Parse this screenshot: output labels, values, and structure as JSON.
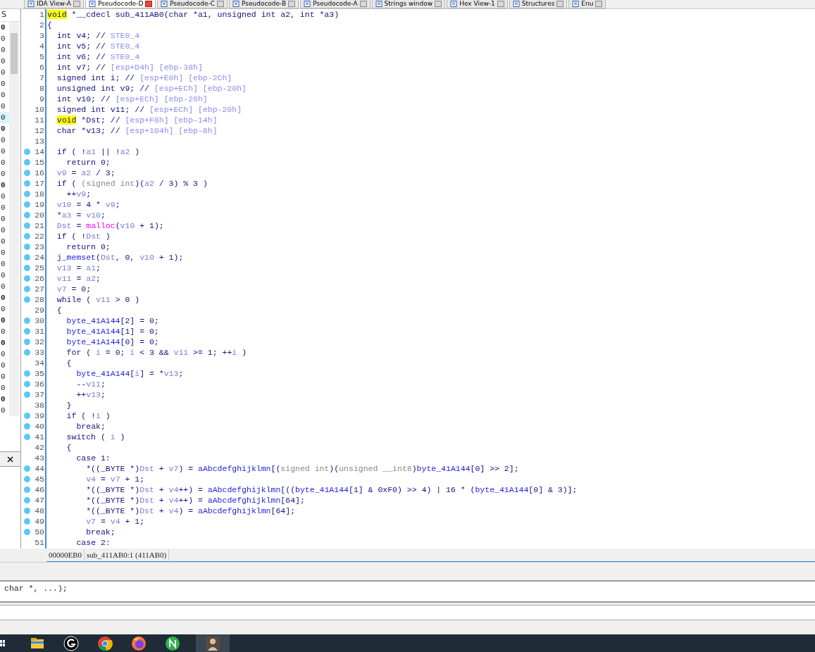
{
  "tabs": [
    {
      "label": "IDA View-A",
      "selected": false
    },
    {
      "label": "Pseudocode-D",
      "selected": true
    },
    {
      "label": "Pseudocode-C",
      "selected": false
    },
    {
      "label": "Pseudocode-B",
      "selected": false
    },
    {
      "label": "Pseudocode-A",
      "selected": false
    },
    {
      "label": "Strings window",
      "selected": false
    },
    {
      "label": "Hex View-1",
      "selected": false
    },
    {
      "label": "Structures",
      "selected": false
    },
    {
      "label": "Enu",
      "selected": false
    }
  ],
  "left_panel": {
    "header": "S",
    "rows": [
      {
        "text": "0",
        "bold": true,
        "selected": false
      },
      {
        "text": "0",
        "bold": false,
        "selected": false
      },
      {
        "text": "0",
        "bold": false,
        "selected": false
      },
      {
        "text": "0",
        "bold": false,
        "selected": false
      },
      {
        "text": "0",
        "bold": false,
        "selected": false
      },
      {
        "text": "0",
        "bold": false,
        "selected": false
      },
      {
        "text": "0",
        "bold": false,
        "selected": false
      },
      {
        "text": "0",
        "bold": false,
        "selected": false
      },
      {
        "text": "0",
        "bold": false,
        "selected": true
      },
      {
        "text": "0",
        "bold": true,
        "selected": false
      },
      {
        "text": "0",
        "bold": false,
        "selected": false
      },
      {
        "text": "0",
        "bold": false,
        "selected": false
      },
      {
        "text": "0",
        "bold": false,
        "selected": false
      },
      {
        "text": "0",
        "bold": false,
        "selected": false
      },
      {
        "text": "0",
        "bold": true,
        "selected": false
      },
      {
        "text": "0",
        "bold": false,
        "selected": false
      },
      {
        "text": "0",
        "bold": false,
        "selected": false
      },
      {
        "text": "0",
        "bold": false,
        "selected": false
      },
      {
        "text": "0",
        "bold": false,
        "selected": false
      },
      {
        "text": "0",
        "bold": false,
        "selected": false
      },
      {
        "text": "0",
        "bold": false,
        "selected": false
      },
      {
        "text": "0",
        "bold": false,
        "selected": false
      },
      {
        "text": "0",
        "bold": false,
        "selected": false
      },
      {
        "text": "0",
        "bold": false,
        "selected": false
      },
      {
        "text": "0",
        "bold": true,
        "selected": false
      },
      {
        "text": "0",
        "bold": false,
        "selected": false
      },
      {
        "text": "0",
        "bold": true,
        "selected": false
      },
      {
        "text": "0",
        "bold": false,
        "selected": false
      },
      {
        "text": "0",
        "bold": true,
        "selected": false
      },
      {
        "text": "0",
        "bold": false,
        "selected": false
      },
      {
        "text": "0",
        "bold": false,
        "selected": false
      },
      {
        "text": "0",
        "bold": false,
        "selected": false
      },
      {
        "text": "0",
        "bold": false,
        "selected": false
      },
      {
        "text": "0",
        "bold": true,
        "selected": false
      },
      {
        "text": "0",
        "bold": false,
        "selected": false
      }
    ]
  },
  "code_lines": [
    {
      "number": "1",
      "breakpoint": false,
      "code": [
        {
          "kind": "hl",
          "text": "void"
        },
        {
          "kind": "plain",
          "text": " *__cdecl sub_411AB0(char *a1, unsigned int a2, int *a3)"
        }
      ]
    },
    {
      "number": "2",
      "breakpoint": false,
      "code": [
        {
          "kind": "plain",
          "text": "{"
        }
      ]
    },
    {
      "number": "3",
      "breakpoint": false,
      "code": [
        {
          "kind": "plain",
          "text": "  int v4; // "
        },
        {
          "kind": "comment",
          "text": "STE0_4"
        }
      ]
    },
    {
      "number": "4",
      "breakpoint": false,
      "code": [
        {
          "kind": "plain",
          "text": "  int v5; // "
        },
        {
          "kind": "comment",
          "text": "STE0_4"
        }
      ]
    },
    {
      "number": "5",
      "breakpoint": false,
      "code": [
        {
          "kind": "plain",
          "text": "  int v6; // "
        },
        {
          "kind": "comment",
          "text": "STE0_4"
        }
      ]
    },
    {
      "number": "6",
      "breakpoint": false,
      "code": [
        {
          "kind": "plain",
          "text": "  int v7; // "
        },
        {
          "kind": "comment",
          "text": "[esp+D4h] [ebp-38h]"
        }
      ]
    },
    {
      "number": "7",
      "breakpoint": false,
      "code": [
        {
          "kind": "plain",
          "text": "  signed int i; // "
        },
        {
          "kind": "comment",
          "text": "[esp+E0h] [ebp-2Ch]"
        }
      ]
    },
    {
      "number": "8",
      "breakpoint": false,
      "code": [
        {
          "kind": "plain",
          "text": "  unsigned int v9; // "
        },
        {
          "kind": "comment",
          "text": "[esp+ECh] [ebp-20h]"
        }
      ]
    },
    {
      "number": "9",
      "breakpoint": false,
      "code": [
        {
          "kind": "plain",
          "text": "  int v10; // "
        },
        {
          "kind": "comment",
          "text": "[esp+ECh] [ebp-20h]"
        }
      ]
    },
    {
      "number": "10",
      "breakpoint": false,
      "code": [
        {
          "kind": "plain",
          "text": "  signed int v11; // "
        },
        {
          "kind": "comment",
          "text": "[esp+ECh] [ebp-20h]"
        }
      ]
    },
    {
      "number": "11",
      "breakpoint": false,
      "code": [
        {
          "kind": "hl",
          "text": "  void"
        },
        {
          "kind": "plain",
          "text": " *Dst; // "
        },
        {
          "kind": "comment",
          "text": "[esp+F8h] [ebp-14h]"
        }
      ]
    },
    {
      "number": "12",
      "breakpoint": false,
      "code": [
        {
          "kind": "plain",
          "text": "  char *v13; // "
        },
        {
          "kind": "comment",
          "text": "[esp+104h] [ebp-8h]"
        }
      ]
    },
    {
      "number": "13",
      "breakpoint": false
    },
    {
      "number": "14",
      "breakpoint": true,
      "code": [
        {
          "kind": "plain",
          "text": "  if ( !"
        },
        {
          "kind": "var",
          "text": "a1"
        },
        {
          "kind": "plain",
          "text": " || !"
        },
        {
          "kind": "var",
          "text": "a2"
        },
        {
          "kind": "plain",
          "text": " )"
        }
      ]
    },
    {
      "number": "15",
      "breakpoint": true,
      "code": [
        {
          "kind": "plain",
          "text": "    return 0;"
        }
      ]
    },
    {
      "number": "16",
      "breakpoint": true,
      "code": [
        {
          "kind": "var",
          "text": "  v9"
        },
        {
          "kind": "plain",
          "text": " = "
        },
        {
          "kind": "var",
          "text": "a2"
        },
        {
          "kind": "plain",
          "text": " / 3;"
        }
      ]
    },
    {
      "number": "17",
      "breakpoint": true,
      "code": [
        {
          "kind": "plain",
          "text": "  if ( "
        },
        {
          "kind": "cast",
          "text": "(signed int"
        },
        {
          "kind": "plain",
          "text": ")("
        },
        {
          "kind": "var",
          "text": "a2"
        },
        {
          "kind": "plain",
          "text": " / 3) % 3 )"
        }
      ]
    },
    {
      "number": "18",
      "breakpoint": true,
      "code": [
        {
          "kind": "plain",
          "text": "    ++"
        },
        {
          "kind": "var",
          "text": "v9"
        },
        {
          "kind": "plain",
          "text": ";"
        }
      ]
    },
    {
      "number": "19",
      "breakpoint": true,
      "code": [
        {
          "kind": "var",
          "text": "  v10"
        },
        {
          "kind": "plain",
          "text": " = 4 * "
        },
        {
          "kind": "var",
          "text": "v9"
        },
        {
          "kind": "plain",
          "text": ";"
        }
      ]
    },
    {
      "number": "20",
      "breakpoint": true,
      "code": [
        {
          "kind": "plain",
          "text": "  *"
        },
        {
          "kind": "var",
          "text": "a3"
        },
        {
          "kind": "plain",
          "text": " = "
        },
        {
          "kind": "var",
          "text": "v10"
        },
        {
          "kind": "plain",
          "text": ";"
        }
      ]
    },
    {
      "number": "21",
      "breakpoint": true,
      "code": [
        {
          "kind": "var",
          "text": "  Dst"
        },
        {
          "kind": "plain",
          "text": " = "
        },
        {
          "kind": "func",
          "text": "malloc"
        },
        {
          "kind": "plain",
          "text": "("
        },
        {
          "kind": "var",
          "text": "v10"
        },
        {
          "kind": "plain",
          "text": " + 1);"
        }
      ]
    },
    {
      "number": "22",
      "breakpoint": true,
      "code": [
        {
          "kind": "plain",
          "text": "  if ( !"
        },
        {
          "kind": "var",
          "text": "Dst"
        },
        {
          "kind": "plain",
          "text": " )"
        }
      ]
    },
    {
      "number": "23",
      "breakpoint": true,
      "code": [
        {
          "kind": "plain",
          "text": "    return 0;"
        }
      ]
    },
    {
      "number": "24",
      "breakpoint": true,
      "code": [
        {
          "kind": "global",
          "text": "  j_memset"
        },
        {
          "kind": "plain",
          "text": "("
        },
        {
          "kind": "var",
          "text": "Dst"
        },
        {
          "kind": "plain",
          "text": ", 0, "
        },
        {
          "kind": "var",
          "text": "v10"
        },
        {
          "kind": "plain",
          "text": " + 1);"
        }
      ]
    },
    {
      "number": "25",
      "breakpoint": true,
      "code": [
        {
          "kind": "var",
          "text": "  v13"
        },
        {
          "kind": "plain",
          "text": " = "
        },
        {
          "kind": "var",
          "text": "a1"
        },
        {
          "kind": "plain",
          "text": ";"
        }
      ]
    },
    {
      "number": "26",
      "breakpoint": true,
      "code": [
        {
          "kind": "var",
          "text": "  v11"
        },
        {
          "kind": "plain",
          "text": " = "
        },
        {
          "kind": "var",
          "text": "a2"
        },
        {
          "kind": "plain",
          "text": ";"
        }
      ]
    },
    {
      "number": "27",
      "breakpoint": true,
      "code": [
        {
          "kind": "var",
          "text": "  v7"
        },
        {
          "kind": "plain",
          "text": " = 0;"
        }
      ]
    },
    {
      "number": "28",
      "breakpoint": true,
      "code": [
        {
          "kind": "plain",
          "text": "  while ( "
        },
        {
          "kind": "var",
          "text": "v11"
        },
        {
          "kind": "plain",
          "text": " > 0 )"
        }
      ]
    },
    {
      "number": "29",
      "breakpoint": false,
      "code": [
        {
          "kind": "plain",
          "text": "  {"
        }
      ]
    },
    {
      "number": "30",
      "breakpoint": true,
      "code": [
        {
          "kind": "global",
          "text": "    byte_41A144"
        },
        {
          "kind": "plain",
          "text": "[2] = 0;"
        }
      ]
    },
    {
      "number": "31",
      "breakpoint": true,
      "code": [
        {
          "kind": "global",
          "text": "    byte_41A144"
        },
        {
          "kind": "plain",
          "text": "[1] = 0;"
        }
      ]
    },
    {
      "number": "32",
      "breakpoint": true,
      "code": [
        {
          "kind": "global",
          "text": "    byte_41A144"
        },
        {
          "kind": "plain",
          "text": "[0] = 0;"
        }
      ]
    },
    {
      "number": "33",
      "breakpoint": true,
      "code": [
        {
          "kind": "plain",
          "text": "    for ( "
        },
        {
          "kind": "var",
          "text": "i"
        },
        {
          "kind": "plain",
          "text": " = 0; "
        },
        {
          "kind": "var",
          "text": "i"
        },
        {
          "kind": "plain",
          "text": " < 3 && "
        },
        {
          "kind": "var",
          "text": "v11"
        },
        {
          "kind": "plain",
          "text": " >= 1; ++"
        },
        {
          "kind": "var",
          "text": "i"
        },
        {
          "kind": "plain",
          "text": " )"
        }
      ]
    },
    {
      "number": "34",
      "breakpoint": false,
      "code": [
        {
          "kind": "plain",
          "text": "    {"
        }
      ]
    },
    {
      "number": "35",
      "breakpoint": true,
      "code": [
        {
          "kind": "global",
          "text": "      byte_41A144"
        },
        {
          "kind": "plain",
          "text": "["
        },
        {
          "kind": "var",
          "text": "i"
        },
        {
          "kind": "plain",
          "text": "] = *"
        },
        {
          "kind": "var",
          "text": "v13"
        },
        {
          "kind": "plain",
          "text": ";"
        }
      ]
    },
    {
      "number": "36",
      "breakpoint": true,
      "code": [
        {
          "kind": "plain",
          "text": "      --"
        },
        {
          "kind": "var",
          "text": "v11"
        },
        {
          "kind": "plain",
          "text": ";"
        }
      ]
    },
    {
      "number": "37",
      "breakpoint": true,
      "code": [
        {
          "kind": "plain",
          "text": "      ++"
        },
        {
          "kind": "var",
          "text": "v13"
        },
        {
          "kind": "plain",
          "text": ";"
        }
      ]
    },
    {
      "number": "38",
      "breakpoint": false,
      "code": [
        {
          "kind": "plain",
          "text": "    }"
        }
      ]
    },
    {
      "number": "39",
      "breakpoint": true,
      "code": [
        {
          "kind": "plain",
          "text": "    if ( !"
        },
        {
          "kind": "var",
          "text": "i"
        },
        {
          "kind": "plain",
          "text": " )"
        }
      ]
    },
    {
      "number": "40",
      "breakpoint": true,
      "code": [
        {
          "kind": "plain",
          "text": "      break;"
        }
      ]
    },
    {
      "number": "41",
      "breakpoint": true,
      "code": [
        {
          "kind": "plain",
          "text": "    switch ( "
        },
        {
          "kind": "var",
          "text": "i"
        },
        {
          "kind": "plain",
          "text": " )"
        }
      ]
    },
    {
      "number": "42",
      "breakpoint": false,
      "code": [
        {
          "kind": "plain",
          "text": "    {"
        }
      ]
    },
    {
      "number": "43",
      "breakpoint": false,
      "code": [
        {
          "kind": "plain",
          "text": "      case 1:"
        }
      ]
    },
    {
      "number": "44",
      "breakpoint": true,
      "code": [
        {
          "kind": "plain",
          "text": "        *((_BYTE *)"
        },
        {
          "kind": "var",
          "text": "Dst"
        },
        {
          "kind": "plain",
          "text": " + "
        },
        {
          "kind": "var",
          "text": "v7"
        },
        {
          "kind": "plain",
          "text": ") = "
        },
        {
          "kind": "global",
          "text": "aAbcdefghijklmn"
        },
        {
          "kind": "plain",
          "text": "[("
        },
        {
          "kind": "cast",
          "text": "signed int"
        },
        {
          "kind": "plain",
          "text": ")("
        },
        {
          "kind": "cast",
          "text": "unsigned __int8"
        },
        {
          "kind": "plain",
          "text": ")"
        },
        {
          "kind": "global",
          "text": "byte_41A144"
        },
        {
          "kind": "plain",
          "text": "[0] >> 2];"
        }
      ]
    },
    {
      "number": "45",
      "breakpoint": true,
      "code": [
        {
          "kind": "var",
          "text": "        v4"
        },
        {
          "kind": "plain",
          "text": " = "
        },
        {
          "kind": "var",
          "text": "v7"
        },
        {
          "kind": "plain",
          "text": " + 1;"
        }
      ]
    },
    {
      "number": "46",
      "breakpoint": true,
      "code": [
        {
          "kind": "plain",
          "text": "        *((_BYTE *)"
        },
        {
          "kind": "var",
          "text": "Dst"
        },
        {
          "kind": "plain",
          "text": " + "
        },
        {
          "kind": "var",
          "text": "v4"
        },
        {
          "kind": "plain",
          "text": "++) = "
        },
        {
          "kind": "global",
          "text": "aAbcdefghijklmn"
        },
        {
          "kind": "plain",
          "text": "[(("
        },
        {
          "kind": "global",
          "text": "byte_41A144"
        },
        {
          "kind": "plain",
          "text": "[1] & 0xF0) >> 4) | 16 * ("
        },
        {
          "kind": "global",
          "text": "byte_41A144"
        },
        {
          "kind": "plain",
          "text": "[0] & 3)];"
        }
      ]
    },
    {
      "number": "47",
      "breakpoint": true,
      "code": [
        {
          "kind": "plain",
          "text": "        *((_BYTE *)"
        },
        {
          "kind": "var",
          "text": "Dst"
        },
        {
          "kind": "plain",
          "text": " + "
        },
        {
          "kind": "var",
          "text": "v4"
        },
        {
          "kind": "plain",
          "text": "++) = "
        },
        {
          "kind": "global",
          "text": "aAbcdefghijklmn"
        },
        {
          "kind": "plain",
          "text": "[64];"
        }
      ]
    },
    {
      "number": "48",
      "breakpoint": true,
      "code": [
        {
          "kind": "plain",
          "text": "        *((_BYTE *)"
        },
        {
          "kind": "var",
          "text": "Dst"
        },
        {
          "kind": "plain",
          "text": " + "
        },
        {
          "kind": "var",
          "text": "v4"
        },
        {
          "kind": "plain",
          "text": ") = "
        },
        {
          "kind": "global",
          "text": "aAbcdefghijklmn"
        },
        {
          "kind": "plain",
          "text": "[64];"
        }
      ]
    },
    {
      "number": "49",
      "breakpoint": true,
      "code": [
        {
          "kind": "var",
          "text": "        v7"
        },
        {
          "kind": "plain",
          "text": " = "
        },
        {
          "kind": "var",
          "text": "v4"
        },
        {
          "kind": "plain",
          "text": " + 1;"
        }
      ]
    },
    {
      "number": "50",
      "breakpoint": true,
      "code": [
        {
          "kind": "plain",
          "text": "        break;"
        }
      ]
    },
    {
      "number": "51",
      "breakpoint": false,
      "code": [
        {
          "kind": "plain",
          "text": "      case 2:"
        }
      ]
    }
  ],
  "status": {
    "address": "00000EB0",
    "location": "sub_411AB0:1 (411AB0)"
  },
  "output": {
    "text": "char *, ...);"
  },
  "taskbar": {
    "apps": [
      {
        "kind": "folder",
        "selected": false
      },
      {
        "kind": "g",
        "selected": false
      },
      {
        "kind": "chrome",
        "selected": false
      },
      {
        "kind": "firefox",
        "selected": false
      },
      {
        "kind": "n",
        "selected": false
      },
      {
        "kind": "photo",
        "selected": true
      }
    ]
  }
}
